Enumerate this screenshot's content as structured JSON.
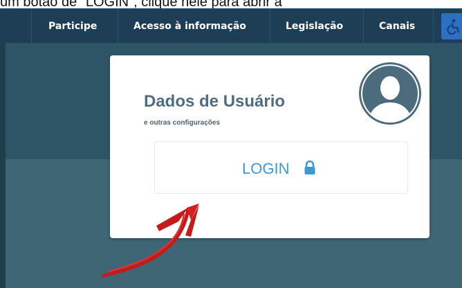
{
  "caption": {
    "text": "um botão de \"LOGIN\", clique nele para abrir a"
  },
  "navbar": {
    "items": [
      {
        "label": "Participe"
      },
      {
        "label": "Acesso à informação"
      },
      {
        "label": "Legislação"
      },
      {
        "label": "Canais"
      }
    ],
    "accessibility_icon": "wheelchair-icon"
  },
  "card": {
    "title": "Dados de Usuário",
    "subtitle": "e outras configurações",
    "avatar_icon": "user-avatar-icon",
    "login_button": {
      "label": "LOGIN",
      "icon": "lock-icon"
    }
  },
  "annotation": {
    "arrow_icon": "red-arrow-icon",
    "arrow_color": "#d42020"
  },
  "colors": {
    "navbar": "#1e3e55",
    "hero_top": "#2e5566",
    "hero_bottom": "#3e6675",
    "title": "#4f6d80",
    "login_text": "#3a9ad6",
    "accessibility_button": "#2d6fc0"
  }
}
